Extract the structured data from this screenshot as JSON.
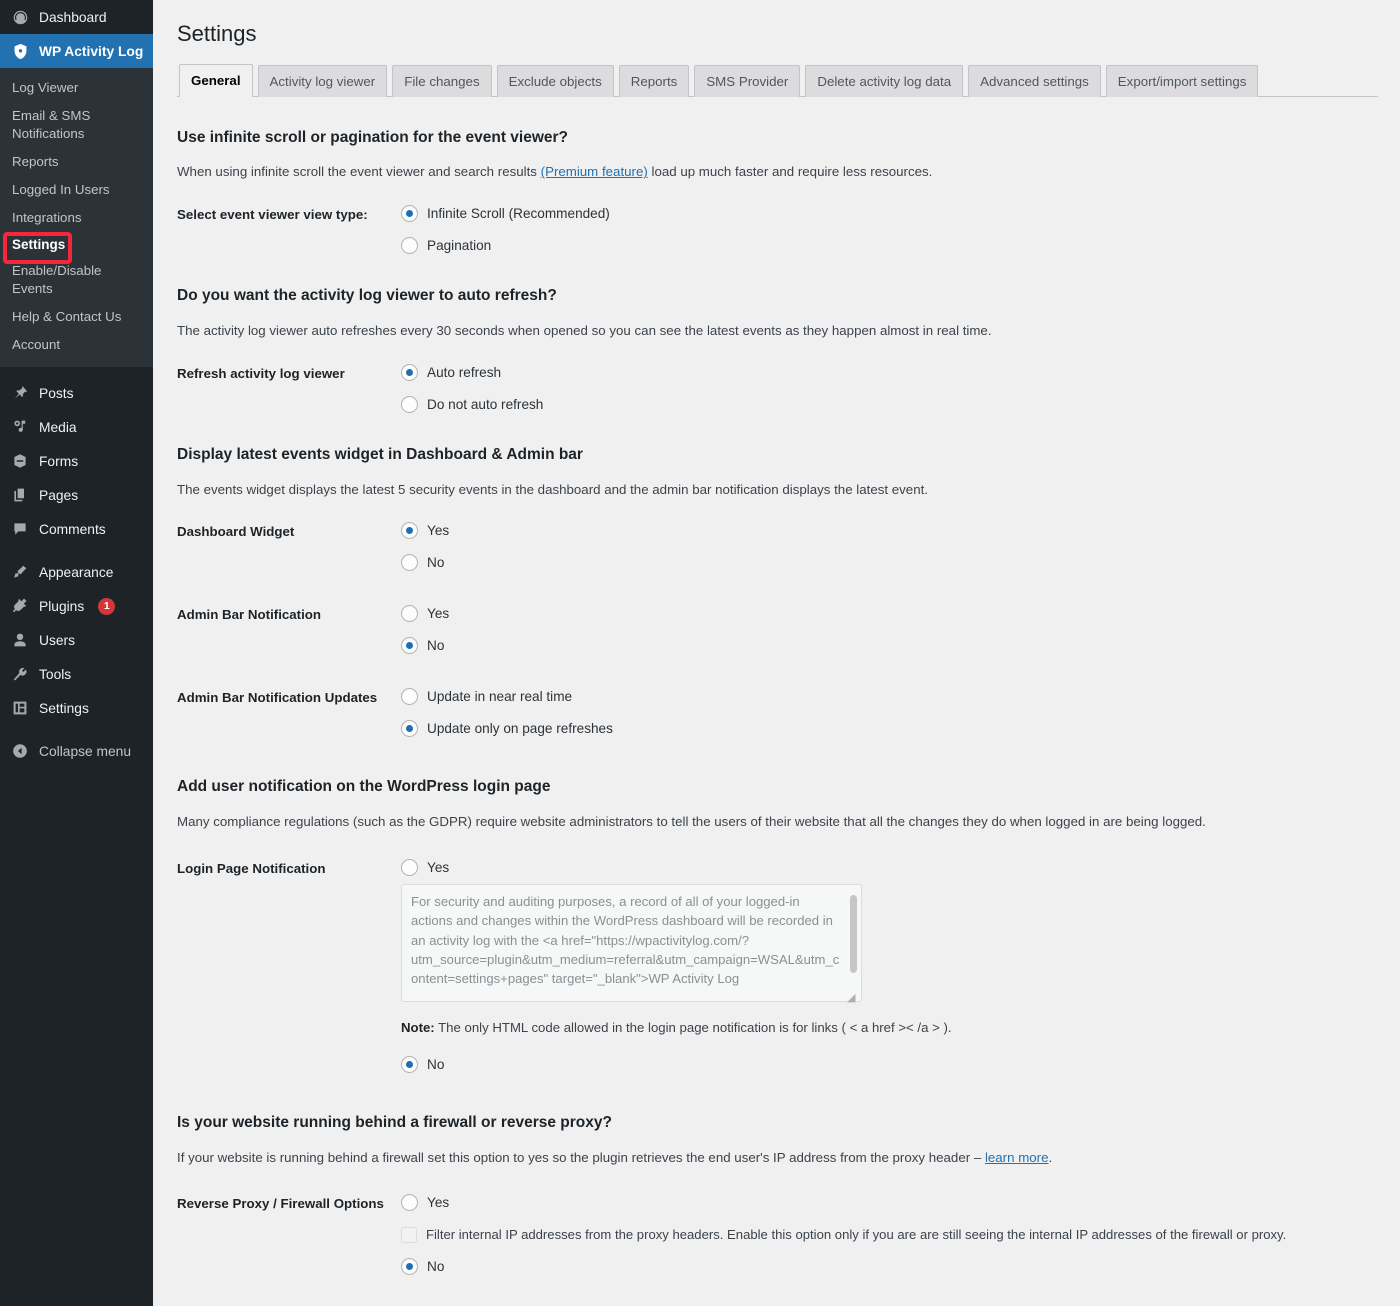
{
  "sidebar": {
    "top": [
      {
        "label": "Dashboard",
        "icon": "dashboard-icon",
        "name": "sidebar-item-dashboard"
      }
    ],
    "current": {
      "label": "WP Activity Log",
      "icon": "shield-icon",
      "name": "sidebar-item-wp-activity-log"
    },
    "submenu": [
      {
        "label": "Log Viewer",
        "name": "sidebar-subitem-log-viewer",
        "highlighted": false
      },
      {
        "label": "Email & SMS Notifications",
        "name": "sidebar-subitem-email-sms-notifications",
        "highlighted": false
      },
      {
        "label": "Reports",
        "name": "sidebar-subitem-reports",
        "highlighted": false
      },
      {
        "label": "Logged In Users",
        "name": "sidebar-subitem-logged-in-users",
        "highlighted": false
      },
      {
        "label": "Integrations",
        "name": "sidebar-subitem-integrations",
        "highlighted": false
      },
      {
        "label": "Settings",
        "name": "sidebar-subitem-settings",
        "highlighted": true
      },
      {
        "label": "Enable/Disable Events",
        "name": "sidebar-subitem-enable-disable-events",
        "highlighted": false
      },
      {
        "label": "Help & Contact Us",
        "name": "sidebar-subitem-help-contact-us",
        "highlighted": false
      },
      {
        "label": "Account",
        "name": "sidebar-subitem-account",
        "highlighted": false
      }
    ],
    "group_a": [
      {
        "label": "Posts",
        "icon": "pin-icon",
        "name": "sidebar-item-posts"
      },
      {
        "label": "Media",
        "icon": "media-icon",
        "name": "sidebar-item-media"
      },
      {
        "label": "Forms",
        "icon": "forms-icon",
        "name": "sidebar-item-forms"
      },
      {
        "label": "Pages",
        "icon": "pages-icon",
        "name": "sidebar-item-pages"
      },
      {
        "label": "Comments",
        "icon": "comment-icon",
        "name": "sidebar-item-comments"
      }
    ],
    "group_b": [
      {
        "label": "Appearance",
        "icon": "brush-icon",
        "name": "sidebar-item-appearance",
        "badge": ""
      },
      {
        "label": "Plugins",
        "icon": "plug-icon",
        "name": "sidebar-item-plugins",
        "badge": "1"
      },
      {
        "label": "Users",
        "icon": "user-icon",
        "name": "sidebar-item-users",
        "badge": ""
      },
      {
        "label": "Tools",
        "icon": "wrench-icon",
        "name": "sidebar-item-tools",
        "badge": ""
      },
      {
        "label": "Settings",
        "icon": "sliders-icon",
        "name": "sidebar-item-settings",
        "badge": ""
      }
    ],
    "collapse": {
      "label": "Collapse menu",
      "icon": "collapse-arrow-icon",
      "name": "sidebar-collapse-menu"
    },
    "highlight_color": "#f4273c",
    "current_color": "#2271b1",
    "badge_color": "#d63638"
  },
  "header": {
    "title": "Settings"
  },
  "tabs": [
    {
      "label": "General",
      "active": true
    },
    {
      "label": "Activity log viewer",
      "active": false
    },
    {
      "label": "File changes",
      "active": false
    },
    {
      "label": "Exclude objects",
      "active": false
    },
    {
      "label": "Reports",
      "active": false
    },
    {
      "label": "SMS Provider",
      "active": false
    },
    {
      "label": "Delete activity log data",
      "active": false
    },
    {
      "label": "Advanced settings",
      "active": false
    },
    {
      "label": "Export/import settings",
      "active": false
    }
  ],
  "sections": {
    "infinite_scroll": {
      "heading": "Use infinite scroll or pagination for the event viewer?",
      "desc_before": "When using infinite scroll the event viewer and search results ",
      "desc_link": "(Premium feature)",
      "desc_after": " load up much faster and require less resources.",
      "field_label": "Select event viewer view type:",
      "options": [
        {
          "label": "Infinite Scroll (Recommended)",
          "checked": true
        },
        {
          "label": "Pagination",
          "checked": false
        }
      ]
    },
    "auto_refresh": {
      "heading": "Do you want the activity log viewer to auto refresh?",
      "desc": "The activity log viewer auto refreshes every 30 seconds when opened so you can see the latest events as they happen almost in real time.",
      "field_label": "Refresh activity log viewer",
      "options": [
        {
          "label": "Auto refresh",
          "checked": true
        },
        {
          "label": "Do not auto refresh",
          "checked": false
        }
      ]
    },
    "latest_events": {
      "heading": "Display latest events widget in Dashboard & Admin bar",
      "desc": "The events widget displays the latest 5 security events in the dashboard and the admin bar notification displays the latest event.",
      "dashboard_widget": {
        "field_label": "Dashboard Widget",
        "options": [
          {
            "label": "Yes",
            "checked": true
          },
          {
            "label": "No",
            "checked": false
          }
        ]
      },
      "admin_bar_notification": {
        "field_label": "Admin Bar Notification",
        "options": [
          {
            "label": "Yes",
            "checked": false
          },
          {
            "label": "No",
            "checked": true
          }
        ]
      },
      "admin_bar_updates": {
        "field_label": "Admin Bar Notification Updates",
        "options": [
          {
            "label": "Update in near real time",
            "checked": false
          },
          {
            "label": "Update only on page refreshes",
            "checked": true
          }
        ]
      }
    },
    "login_notification": {
      "heading": "Add user notification on the WordPress login page",
      "desc": "Many compliance regulations (such as the GDPR) require website administrators to tell the users of their website that all the changes they do when logged in are being logged.",
      "field_label": "Login Page Notification",
      "yes_option": {
        "label": "Yes",
        "checked": false
      },
      "textarea_value": "For security and auditing purposes, a record of all of your logged-in actions and changes within the WordPress dashboard will be recorded in an activity log with the <a href=\"https://wpactivitylog.com/?utm_source=plugin&utm_medium=referral&utm_campaign=WSAL&utm_content=settings+pages\" target=\"_blank\">WP Activity Log",
      "note_bold": "Note:",
      "note_text": " The only HTML code allowed in the login page notification is for links ( < a href >< /a > ).",
      "no_option": {
        "label": "No",
        "checked": true
      }
    },
    "firewall": {
      "heading": "Is your website running behind a firewall or reverse proxy?",
      "desc_before": "If your website is running behind a firewall set this option to yes so the plugin retrieves the end user's IP address from the proxy header – ",
      "desc_link": "learn more",
      "desc_after": ".",
      "field_label": "Reverse Proxy / Firewall Options",
      "yes_option": {
        "label": "Yes",
        "checked": false
      },
      "filter_checkbox": {
        "label": "Filter internal IP addresses from the proxy headers. Enable this option only if you are are still seeing the internal IP addresses of the firewall or proxy.",
        "checked": false
      },
      "no_option": {
        "label": "No",
        "checked": true
      }
    }
  }
}
